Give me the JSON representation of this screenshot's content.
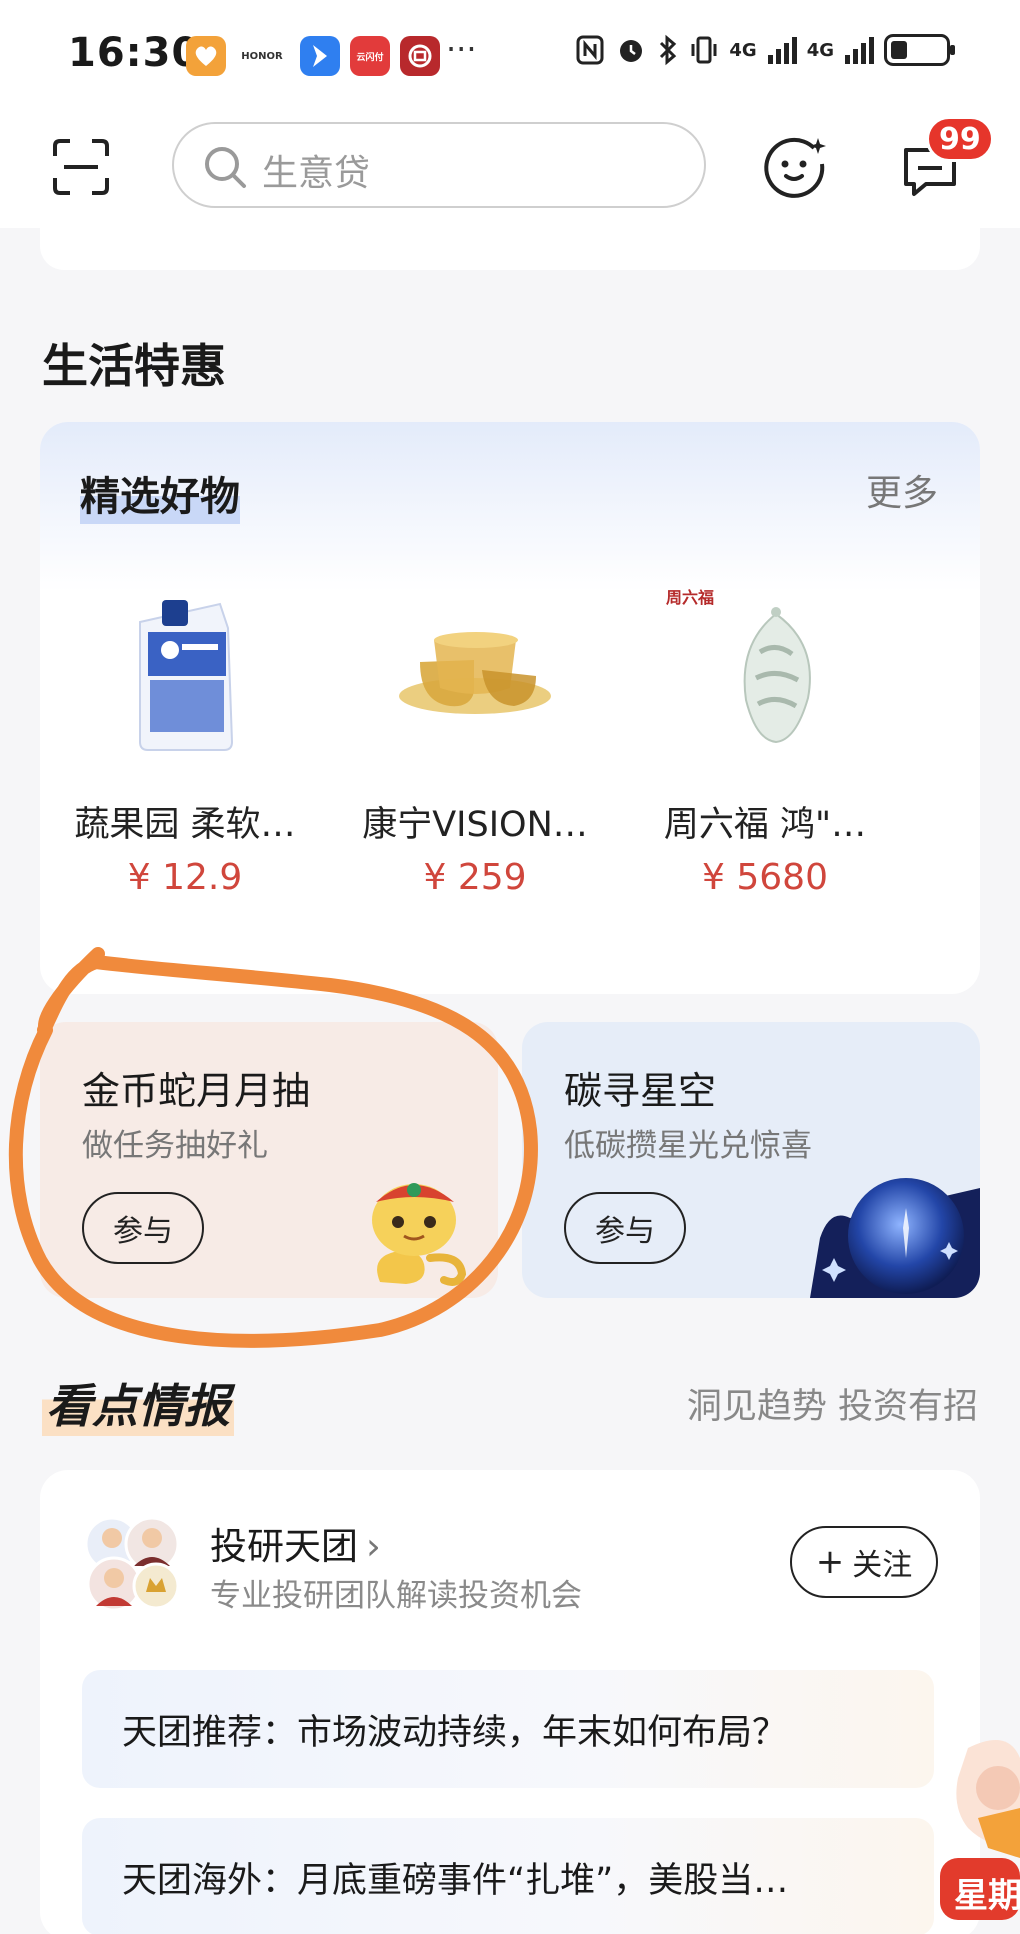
{
  "status_bar": {
    "time": "16:30",
    "signal1": "4G",
    "signal2": "4G",
    "more": "···",
    "apps": [
      {
        "name": "heart-app-icon",
        "color": "#f3a23a",
        "label": ""
      },
      {
        "name": "honor-app-icon",
        "color": "#ffffff",
        "label": "HONOR"
      },
      {
        "name": "blue-arrow-app-icon",
        "color": "#2f7ff0",
        "label": ""
      },
      {
        "name": "yunshanfu-app-icon",
        "color": "#e23b3b",
        "label": "云闪付"
      },
      {
        "name": "icbc-app-icon",
        "color": "#b8292c",
        "label": ""
      }
    ]
  },
  "header": {
    "search_placeholder": "生意贷",
    "badge_count": "99"
  },
  "life_deals": {
    "section_title": "生活特惠",
    "card_title": "精选好物",
    "more": "更多",
    "products": [
      {
        "name": "蔬果园 柔软…",
        "price": "¥ 12.9",
        "image": "detergent-bottle"
      },
      {
        "name": "康宁VISION…",
        "price": "¥ 259",
        "image": "amber-glass-cookware"
      },
      {
        "name": "周六福 鸿\"…",
        "price": "¥ 5680",
        "image": "jade-pendant",
        "brand_mark": "周六福"
      }
    ]
  },
  "promos": [
    {
      "title": "金币蛇月月抽",
      "subtitle": "做任务抽好礼",
      "button": "参与",
      "image": "golden-snake-mascot"
    },
    {
      "title": "碳寻星空",
      "subtitle": "低碳攒星光兑惊喜",
      "button": "参与",
      "image": "blue-planet-sphere"
    }
  ],
  "insights": {
    "title": "看点情报",
    "slogan": "洞见趋势 投资有招",
    "team_name": "投研天团",
    "team_desc": "专业投研团队解读投资机会",
    "follow_label": "关注",
    "news": [
      "天团推荐：市场波动持续，年末如何布局？",
      "天团海外：月底重磅事件“扎堆”，美股当…"
    ]
  },
  "float_widget": {
    "text": "星期"
  },
  "colors": {
    "price": "#d0463c",
    "badge": "#e6352b",
    "annotation": "#f08a3c"
  }
}
